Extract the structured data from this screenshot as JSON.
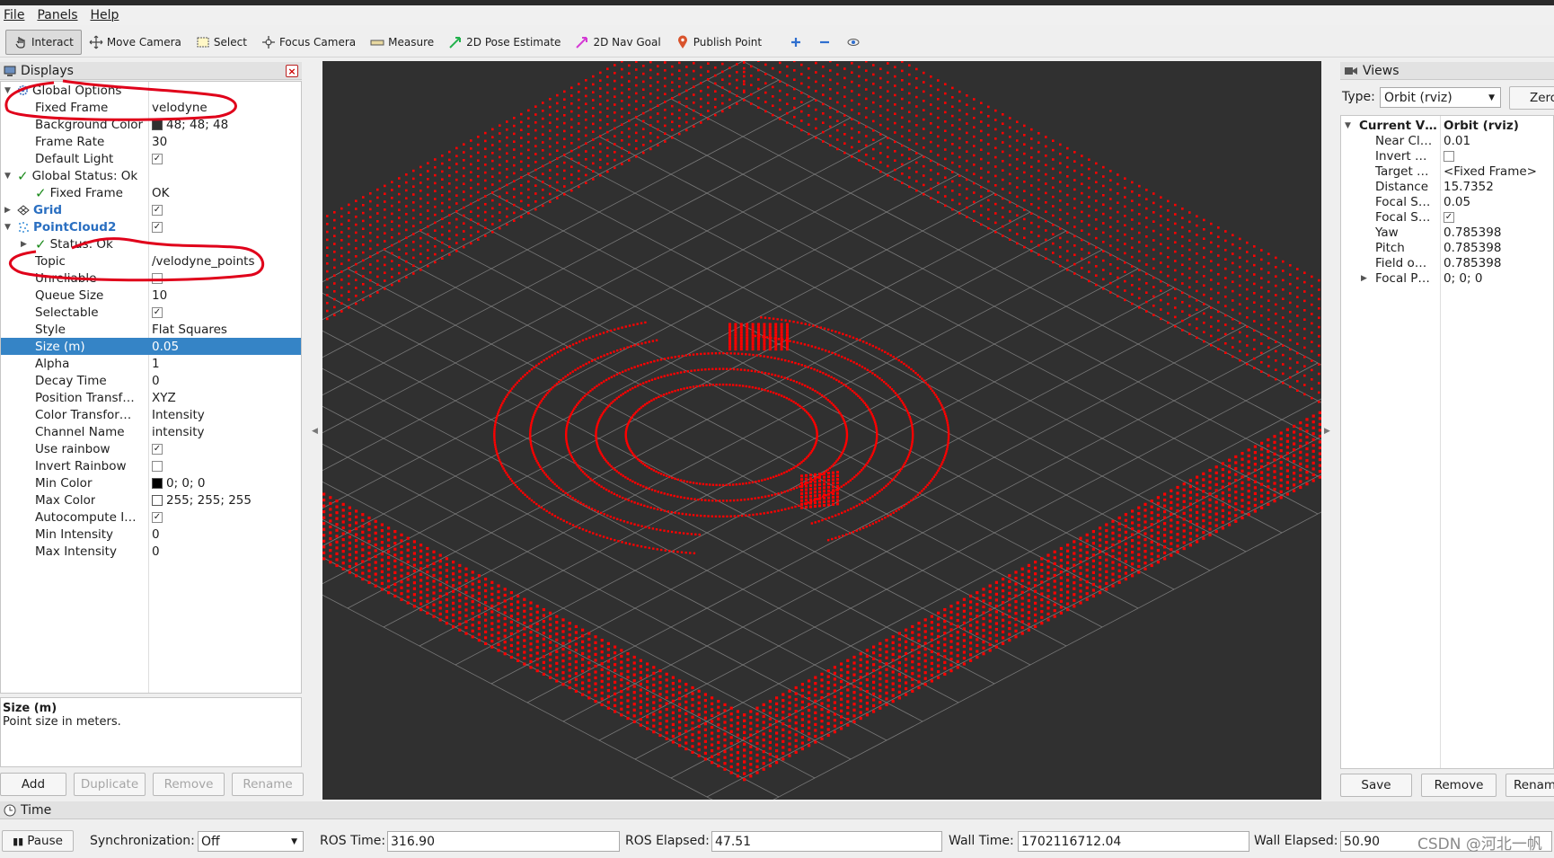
{
  "menu": [
    "File",
    "Panels",
    "Help"
  ],
  "toolbar": {
    "tools": [
      {
        "label": "Interact",
        "icon": "hand-pointer-icon"
      },
      {
        "label": "Move Camera",
        "icon": "move-arrows-icon"
      },
      {
        "label": "Select",
        "icon": "select-box-icon"
      },
      {
        "label": "Focus Camera",
        "icon": "focus-target-icon"
      },
      {
        "label": "Measure",
        "icon": "ruler-icon"
      },
      {
        "label": "2D Pose Estimate",
        "icon": "green-arrow-icon"
      },
      {
        "label": "2D Nav Goal",
        "icon": "magenta-arrow-icon"
      },
      {
        "label": "Publish Point",
        "icon": "map-pin-icon"
      }
    ]
  },
  "displays": {
    "title": "Displays",
    "rows": [
      {
        "label": "Global Options",
        "value": ""
      },
      {
        "label": "Fixed Frame",
        "value": "velodyne"
      },
      {
        "label": "Background Color",
        "value": "48; 48; 48"
      },
      {
        "label": "Frame Rate",
        "value": "30"
      },
      {
        "label": "Default Light",
        "value": ""
      },
      {
        "label": "Global Status: Ok",
        "value": ""
      },
      {
        "label": "Fixed Frame",
        "value": "OK"
      },
      {
        "label": "Grid",
        "value": ""
      },
      {
        "label": "PointCloud2",
        "value": ""
      },
      {
        "label": "Status: Ok",
        "value": ""
      },
      {
        "label": "Topic",
        "value": "/velodyne_points"
      },
      {
        "label": "Unreliable",
        "value": ""
      },
      {
        "label": "Queue Size",
        "value": "10"
      },
      {
        "label": "Selectable",
        "value": ""
      },
      {
        "label": "Style",
        "value": "Flat Squares"
      },
      {
        "label": "Size (m)",
        "value": "0.05"
      },
      {
        "label": "Alpha",
        "value": "1"
      },
      {
        "label": "Decay Time",
        "value": "0"
      },
      {
        "label": "Position Transf…",
        "value": "XYZ"
      },
      {
        "label": "Color Transfor…",
        "value": "Intensity"
      },
      {
        "label": "Channel Name",
        "value": "intensity"
      },
      {
        "label": "Use rainbow",
        "value": ""
      },
      {
        "label": "Invert Rainbow",
        "value": ""
      },
      {
        "label": "Min Color",
        "value": "0; 0; 0"
      },
      {
        "label": "Max Color",
        "value": "255; 255; 255"
      },
      {
        "label": "Autocompute I…",
        "value": ""
      },
      {
        "label": "Min Intensity",
        "value": "0"
      },
      {
        "label": "Max Intensity",
        "value": "0"
      }
    ],
    "help_title": "Size (m)",
    "help_text": "Point size in meters.",
    "buttons": [
      "Add",
      "Duplicate",
      "Remove",
      "Rename"
    ]
  },
  "views": {
    "title": "Views",
    "type_label": "Type:",
    "type_value": "Orbit (rviz)",
    "zero_button": "Zero",
    "rows": [
      {
        "label": "Current V…",
        "value": "Orbit (rviz)"
      },
      {
        "label": "Near Cl…",
        "value": "0.01"
      },
      {
        "label": "Invert …",
        "value": ""
      },
      {
        "label": "Target …",
        "value": "<Fixed Frame>"
      },
      {
        "label": "Distance",
        "value": "15.7352"
      },
      {
        "label": "Focal S…",
        "value": "0.05"
      },
      {
        "label": "Focal S…",
        "value": ""
      },
      {
        "label": "Yaw",
        "value": "0.785398"
      },
      {
        "label": "Pitch",
        "value": "0.785398"
      },
      {
        "label": "Field o…",
        "value": "0.785398"
      },
      {
        "label": "Focal P…",
        "value": "0; 0; 0"
      }
    ],
    "buttons": [
      "Save",
      "Remove",
      "Rename"
    ]
  },
  "time": {
    "title": "Time",
    "pause": "Pause",
    "sync_label": "Synchronization:",
    "sync_value": "Off",
    "ros_time_label": "ROS Time:",
    "ros_time": "316.90",
    "ros_elapsed_label": "ROS Elapsed:",
    "ros_elapsed": "47.51",
    "wall_time_label": "Wall Time:",
    "wall_time": "1702116712.04",
    "wall_elapsed_label": "Wall Elapsed:",
    "wall_elapsed": "50.90"
  },
  "watermark": "CSDN @河北一帆",
  "colors": {
    "viewport_bg": "#303030",
    "points": "#ff0000",
    "selection": "#3584c6",
    "annotation": "#e0001a"
  }
}
